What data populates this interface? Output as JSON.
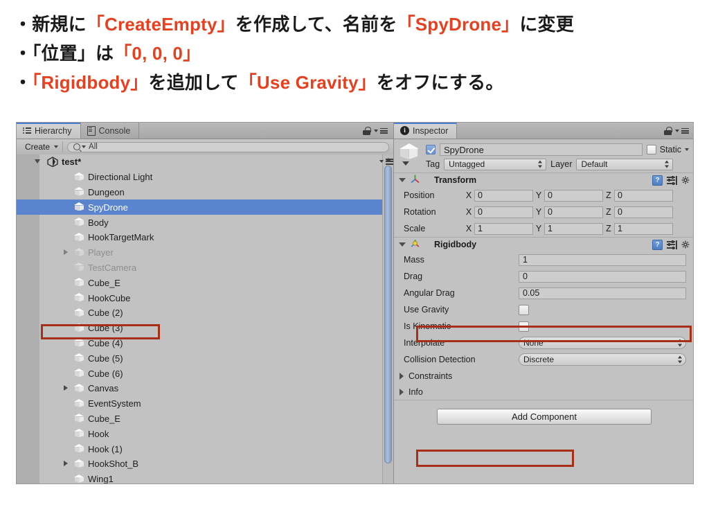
{
  "instructions": {
    "line1": [
      {
        "t": "・新規に",
        "em": false
      },
      {
        "t": "「CreateEmpty」",
        "em": true
      },
      {
        "t": "を作成して、名前を",
        "em": false
      },
      {
        "t": "「SpyDrone」",
        "em": true
      },
      {
        "t": "に変更",
        "em": false
      }
    ],
    "line2": [
      {
        "t": "・",
        "em": false
      },
      {
        "t": "「位置」",
        "em": false
      },
      {
        "t": "は",
        "em": false
      },
      {
        "t": "「0, 0, 0」",
        "em": true
      }
    ],
    "line3": [
      {
        "t": "・",
        "em": false
      },
      {
        "t": "「Rigidbody」",
        "em": true
      },
      {
        "t": "を追加して",
        "em": false
      },
      {
        "t": "「Use Gravity」",
        "em": true
      },
      {
        "t": "をオフにする。",
        "em": false
      }
    ],
    "accent_color": "#e8401f"
  },
  "hierarchy": {
    "tabs": [
      {
        "label": "Hierarchy",
        "icon": "hierarchy-icon",
        "active": true
      },
      {
        "label": "Console",
        "icon": "console-icon",
        "active": false
      }
    ],
    "lock_icon": "lock-icon",
    "menu_icon": "hamburger-menu-icon",
    "toolbar": {
      "create_label": "Create",
      "search_placeholder": "All",
      "search_value": "All",
      "search_icon": "search-icon"
    },
    "scene": {
      "label": "test*",
      "expanded": true,
      "icon": "unity-scene-icon"
    },
    "items": [
      {
        "label": "Directional Light",
        "indent": 1,
        "expandable": false,
        "dim": false,
        "selected": false
      },
      {
        "label": "Dungeon",
        "indent": 1,
        "expandable": false,
        "dim": false,
        "selected": false
      },
      {
        "label": "SpyDrone",
        "indent": 1,
        "expandable": false,
        "dim": false,
        "selected": true
      },
      {
        "label": "Body",
        "indent": 1,
        "expandable": false,
        "dim": false,
        "selected": false
      },
      {
        "label": "HookTargetMark",
        "indent": 1,
        "expandable": false,
        "dim": false,
        "selected": false
      },
      {
        "label": "Player",
        "indent": 1,
        "expandable": true,
        "dim": true,
        "selected": false
      },
      {
        "label": "TestCamera",
        "indent": 1,
        "expandable": false,
        "dim": true,
        "selected": false
      },
      {
        "label": "Cube_E",
        "indent": 1,
        "expandable": false,
        "dim": false,
        "selected": false
      },
      {
        "label": "HookCube",
        "indent": 1,
        "expandable": false,
        "dim": false,
        "selected": false
      },
      {
        "label": "Cube (2)",
        "indent": 1,
        "expandable": false,
        "dim": false,
        "selected": false
      },
      {
        "label": "Cube (3)",
        "indent": 1,
        "expandable": false,
        "dim": false,
        "selected": false
      },
      {
        "label": "Cube (4)",
        "indent": 1,
        "expandable": false,
        "dim": false,
        "selected": false
      },
      {
        "label": "Cube (5)",
        "indent": 1,
        "expandable": false,
        "dim": false,
        "selected": false
      },
      {
        "label": "Cube (6)",
        "indent": 1,
        "expandable": false,
        "dim": false,
        "selected": false
      },
      {
        "label": "Canvas",
        "indent": 1,
        "expandable": true,
        "dim": false,
        "selected": false
      },
      {
        "label": "EventSystem",
        "indent": 1,
        "expandable": false,
        "dim": false,
        "selected": false
      },
      {
        "label": "Cube_E",
        "indent": 1,
        "expandable": false,
        "dim": false,
        "selected": false
      },
      {
        "label": "Hook",
        "indent": 1,
        "expandable": false,
        "dim": false,
        "selected": false
      },
      {
        "label": "Hook (1)",
        "indent": 1,
        "expandable": false,
        "dim": false,
        "selected": false
      },
      {
        "label": "HookShot_B",
        "indent": 1,
        "expandable": true,
        "dim": false,
        "selected": false
      },
      {
        "label": "Wing1",
        "indent": 1,
        "expandable": false,
        "dim": false,
        "selected": false
      }
    ],
    "selection_color": "#5b84cf"
  },
  "inspector": {
    "tab": {
      "label": "Inspector",
      "icon": "info-icon"
    },
    "lock_icon": "lock-icon",
    "menu_icon": "hamburger-menu-icon",
    "object": {
      "enabled": true,
      "name": "SpyDrone",
      "static_label": "Static",
      "static_checked": false,
      "tag_label": "Tag",
      "tag_value": "Untagged",
      "layer_label": "Layer",
      "layer_value": "Default"
    },
    "components": [
      {
        "name": "Transform",
        "icon": "transform-axis-icon",
        "expanded": true,
        "help_icon": "help-book-icon",
        "preset_icon": "preset-icon",
        "gear_icon": "gear-icon",
        "vectors": [
          {
            "label": "Position",
            "x": "0",
            "y": "0",
            "z": "0",
            "highlight": true
          },
          {
            "label": "Rotation",
            "x": "0",
            "y": "0",
            "z": "0",
            "highlight": false
          },
          {
            "label": "Scale",
            "x": "1",
            "y": "1",
            "z": "1",
            "highlight": false
          }
        ]
      },
      {
        "name": "Rigidbody",
        "icon": "rigidbody-icon",
        "expanded": true,
        "help_icon": "help-book-icon",
        "preset_icon": "preset-icon",
        "gear_icon": "gear-icon",
        "fields": [
          {
            "label": "Mass",
            "type": "text",
            "value": "1"
          },
          {
            "label": "Drag",
            "type": "text",
            "value": "0"
          },
          {
            "label": "Angular Drag",
            "type": "text",
            "value": "0.05"
          },
          {
            "label": "Use Gravity",
            "type": "checkbox",
            "checked": false,
            "highlight": true
          },
          {
            "label": "Is Kinematic",
            "type": "checkbox",
            "checked": false,
            "highlight": false
          },
          {
            "label": "Interpolate",
            "type": "popup",
            "value": "None"
          },
          {
            "label": "Collision Detection",
            "type": "popup",
            "value": "Discrete"
          }
        ],
        "foldouts": [
          {
            "label": "Constraints",
            "expanded": false
          },
          {
            "label": "Info",
            "expanded": false
          }
        ]
      }
    ],
    "add_component_label": "Add Component"
  },
  "annotation_color": "#a82f17"
}
